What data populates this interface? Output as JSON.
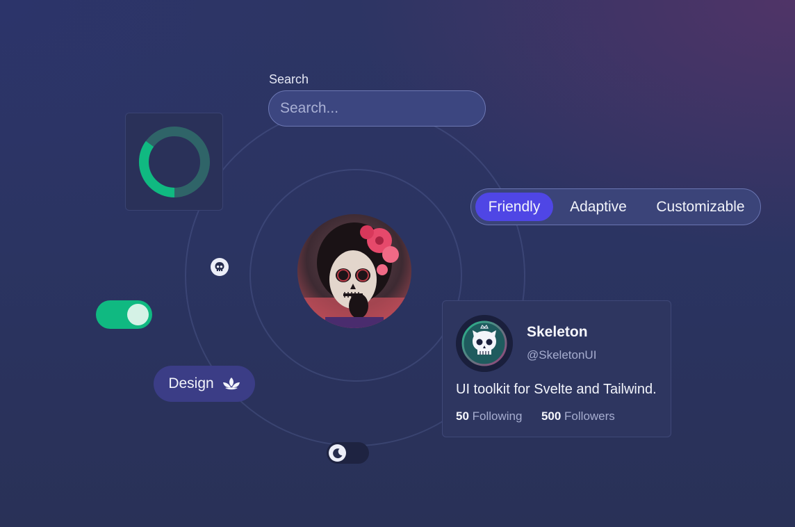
{
  "search": {
    "label": "Search",
    "placeholder": "Search...",
    "value": ""
  },
  "progress_ring": {
    "progress_percent": 35,
    "fill_color": "#10b981",
    "track_color": "#2f6468"
  },
  "segmented_control": {
    "options": [
      "Friendly",
      "Adaptive",
      "Customizable"
    ],
    "selected": "Friendly",
    "accent_color": "#4f46e5"
  },
  "toggle": {
    "state": "on",
    "color": "#10b981"
  },
  "chip": {
    "label": "Design",
    "icon": "lotus-icon"
  },
  "dark_mode_toggle": {
    "state": "off",
    "icon": "moon-icon"
  },
  "avatar": {
    "subject": "sugar-skull-portrait"
  },
  "profile": {
    "name": "Skeleton",
    "handle": "@SkeletonUI",
    "bio": "UI toolkit for Svelte and Tailwind.",
    "following_count": "50",
    "following_label": "Following",
    "followers_count": "500",
    "followers_label": "Followers"
  }
}
